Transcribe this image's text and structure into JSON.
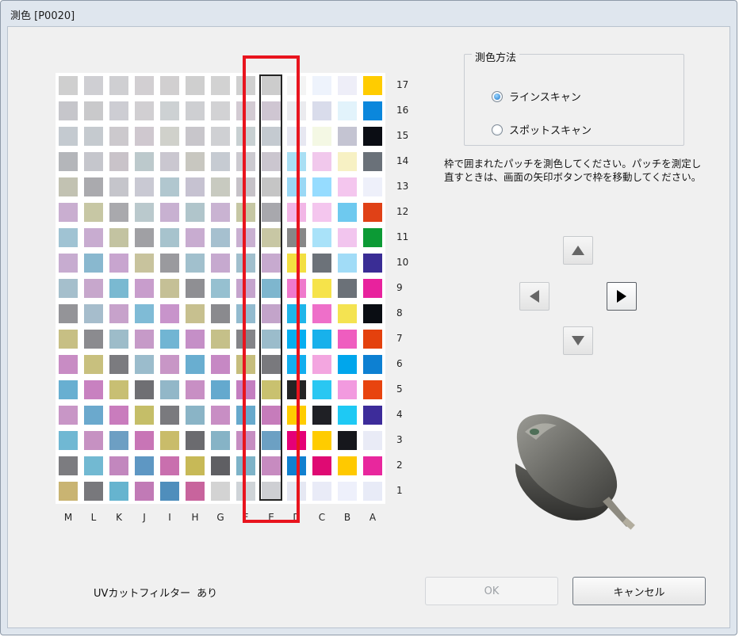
{
  "window": {
    "title": "測色 [P0020]"
  },
  "chart": {
    "row_labels": [
      "17",
      "16",
      "15",
      "14",
      "13",
      "12",
      "11",
      "10",
      "9",
      "8",
      "7",
      "6",
      "5",
      "4",
      "3",
      "2",
      "1"
    ],
    "col_labels": [
      "M",
      "L",
      "K",
      "J",
      "I",
      "H",
      "G",
      "F",
      "E",
      "D",
      "C",
      "B",
      "A"
    ],
    "grid": [
      [
        "#cfcfcf",
        "#cfcfd3",
        "#cfcfd2",
        "#d2cfd2",
        "#d1cfd0",
        "#cfcfcf",
        "#d2d2d2",
        "#d0d0d0",
        "#cccccc",
        "#f4f4f4",
        "#eef3fc",
        "#eeeef8",
        "#ffcc00"
      ],
      [
        "#c6c6cb",
        "#c9c9cb",
        "#cdcdd3",
        "#d1cfd2",
        "#cdd1d3",
        "#cecfd2",
        "#d2d2d4",
        "#d3cbd3",
        "#cfc6d2",
        "#ebebef",
        "#d9dceb",
        "#e2f3fb",
        "#0b87dc"
      ],
      [
        "#c4cad0",
        "#c5cacf",
        "#ccc9cd",
        "#cfc8cf",
        "#d0d1cb",
        "#c8c6cb",
        "#cfd0d3",
        "#c8d0d2",
        "#c4cad0",
        "#e7e7f1",
        "#f4f8e4",
        "#c4c4d2",
        "#0b0d14"
      ],
      [
        "#b4b6ba",
        "#c5c6cc",
        "#c9c3c9",
        "#bcc9cc",
        "#cac7d0",
        "#c8c7c0",
        "#c6cbd2",
        "#cccad0",
        "#cbc6cf",
        "#a9dff4",
        "#f1c8ec",
        "#f7f1c4",
        "#6a7179"
      ],
      [
        "#c2c2b2",
        "#aaaaae",
        "#c5c5cb",
        "#c9c9d3",
        "#b1c7cf",
        "#c6c2d1",
        "#c8cac0",
        "#c6c2c8",
        "#c5c5c5",
        "#9ad8f5",
        "#96dcff",
        "#f4c6ee",
        "#eef0fa"
      ],
      [
        "#c9aed0",
        "#c7c7a4",
        "#a9a9ad",
        "#bac9cd",
        "#c8b1d1",
        "#b0c5cb",
        "#c9b3d2",
        "#c6c7a4",
        "#a8a8ad",
        "#f2b6e6",
        "#f4c6ee",
        "#6ec9ef",
        "#e04117"
      ],
      [
        "#a0c3d3",
        "#c8acd0",
        "#c3c3a1",
        "#a0a0a4",
        "#a7c3cd",
        "#c8acd0",
        "#a6c0cf",
        "#c9b0d1",
        "#c8c7a4",
        "#878787",
        "#a9e2f9",
        "#f2c5ee",
        "#0c9a35"
      ],
      [
        "#c7acd0",
        "#89b8cf",
        "#c8a5cf",
        "#c8c39d",
        "#9a9a9e",
        "#a1c0cd",
        "#c6a9cf",
        "#a1bfcd",
        "#c7aacf",
        "#f3df41",
        "#6c7279",
        "#a1dcf7",
        "#3a2d95"
      ],
      [
        "#a5bfcc",
        "#c7a7cc",
        "#7ab9d1",
        "#c89dcc",
        "#c5c096",
        "#8f8f93",
        "#96c0d0",
        "#c5a4cd",
        "#7eb6ce",
        "#ef79cc",
        "#f6e34a",
        "#6b7178",
        "#e8229d"
      ],
      [
        "#949498",
        "#a6bdcc",
        "#c7a2cb",
        "#7fbbd6",
        "#c894cb",
        "#c7c08f",
        "#8a8a8e",
        "#93bbcf",
        "#c3a4ca",
        "#1fb5e9",
        "#ee6fc9",
        "#f4e351",
        "#0a0d13"
      ],
      [
        "#c7bf84",
        "#8b8b8f",
        "#9dbcc9",
        "#c69ac8",
        "#71b5d3",
        "#c58fc7",
        "#c5c089",
        "#848488",
        "#9bbccb",
        "#05aef0",
        "#18b1eb",
        "#ef5dbf",
        "#e4410d"
      ],
      [
        "#c88cc4",
        "#c8c07e",
        "#7b7b7f",
        "#9bbccc",
        "#c896c6",
        "#69aed0",
        "#c688c4",
        "#c6bd7d",
        "#79797d",
        "#13aeee",
        "#f3a6e0",
        "#00a6ec",
        "#0d80d2"
      ],
      [
        "#68afd1",
        "#c881c0",
        "#c8bf73",
        "#6f6f73",
        "#92b7c8",
        "#c88fc4",
        "#64a9ce",
        "#c47ec0",
        "#c9c16f",
        "#232324",
        "#2ac7f2",
        "#f29adf",
        "#e8440f"
      ],
      [
        "#c896c6",
        "#6ba9cd",
        "#c97cbd",
        "#c5be68",
        "#7a7a7e",
        "#8ab4c6",
        "#c88ec4",
        "#67a9cc",
        "#c67cbb",
        "#ffcc00",
        "#1f2025",
        "#1ec9f4",
        "#3d2c9a"
      ],
      [
        "#70b8d3",
        "#c691c2",
        "#6d9fc3",
        "#c875b6",
        "#c9bc6a",
        "#6b6b6f",
        "#86b3c6",
        "#c68dc1",
        "#6ca0c3",
        "#e50077",
        "#ffcc00",
        "#16171c",
        "#e9ebf6"
      ],
      [
        "#7c7c80",
        "#72b9d2",
        "#c287be",
        "#5e97c3",
        "#c96fae",
        "#c7b957",
        "#5f5f63",
        "#7eb3c8",
        "#c78bc0",
        "#1180cf",
        "#df0a73",
        "#ffc900",
        "#e8279d"
      ],
      [
        "#c9b472",
        "#78787c",
        "#66b4cf",
        "#c17ab6",
        "#4f8ebc",
        "#c8649d",
        "#d3d3d3",
        "#cfd4d8",
        "#cecfd3",
        "#e6e8f3",
        "#e9ebf7",
        "#eef0fb",
        "#e8ebf7"
      ]
    ]
  },
  "method": {
    "legend": "測色方法",
    "options": [
      {
        "label": "ラインスキャン",
        "selected": true
      },
      {
        "label": "スポットスキャン",
        "selected": false
      }
    ]
  },
  "instructions": "枠で囲まれたパッチを測色してください。パッチを測定し直すときは、画面の矢印ボタンで枠を移動してください。",
  "footer": {
    "uv_label": "UVカットフィルター",
    "uv_value": "あり"
  },
  "buttons": {
    "ok": "OK",
    "cancel": "キャンセル"
  },
  "icons": [
    "arrow-up-icon",
    "arrow-left-icon",
    "arrow-right-icon",
    "arrow-down-icon",
    "spectrophotometer-device-icon"
  ]
}
